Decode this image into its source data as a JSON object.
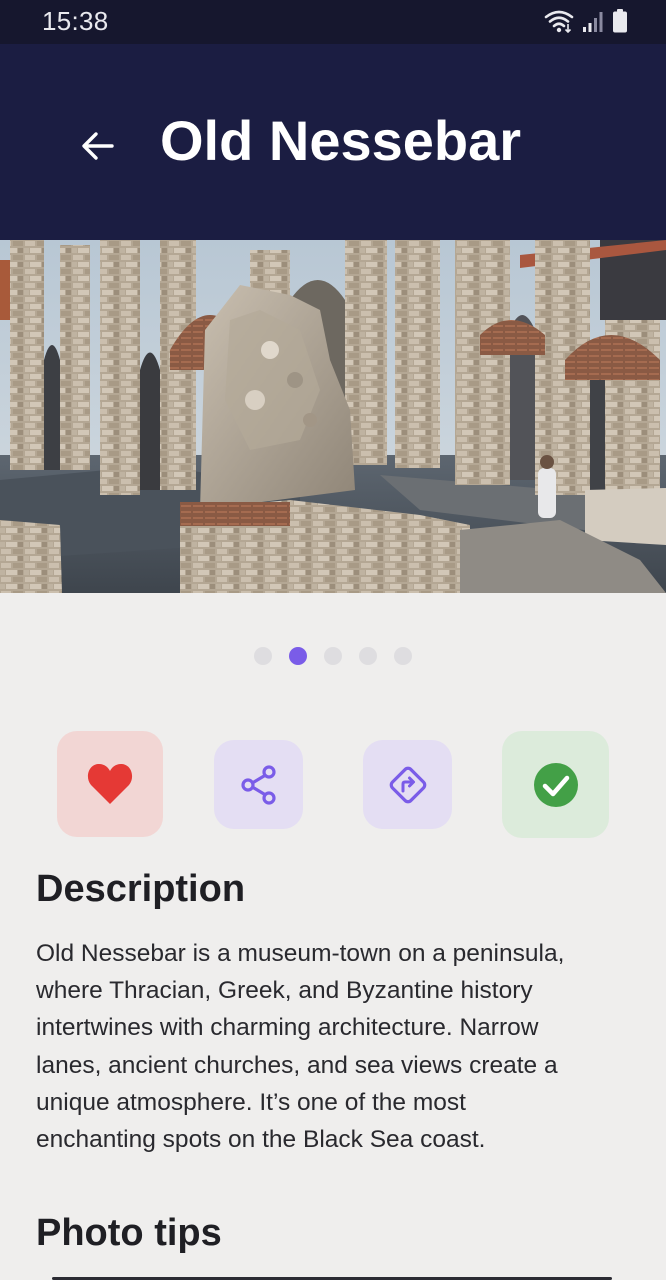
{
  "status_bar": {
    "time": "15:38",
    "icons": [
      "wifi-icon",
      "signal-icon",
      "battery-icon"
    ]
  },
  "app_bar": {
    "title": "Old Nessebar",
    "back_icon": "arrow-left-icon"
  },
  "hero": {
    "icon": "photo-ruins-illustration"
  },
  "carousel": {
    "page_count": 5,
    "active_index": 1
  },
  "actions": [
    {
      "name": "favorite",
      "icon": "heart-icon",
      "color": "#e53935"
    },
    {
      "name": "share",
      "icon": "share-icon",
      "color": "#7a5ce8"
    },
    {
      "name": "directions",
      "icon": "directions-icon",
      "color": "#7a5ce8"
    },
    {
      "name": "visited",
      "icon": "check-circle-icon",
      "color": "#43a047"
    }
  ],
  "description": {
    "title": "Description",
    "lines": [
      "Old Nessebar is a museum-town on a peninsula,",
      "where Thracian, Greek, and Byzantine history",
      "intertwines with charming architecture. Narrow",
      "lanes, ancient churches, and sea views create a",
      "unique atmosphere. It’s one of the most",
      "enchanting spots on the Black Sea coast."
    ]
  },
  "photo_tips": {
    "title": "Photo tips"
  },
  "colors": {
    "app_bar": "#1b1d42",
    "status_bar": "#16172e",
    "accent": "#7a5ce8",
    "background": "#efeeed"
  }
}
